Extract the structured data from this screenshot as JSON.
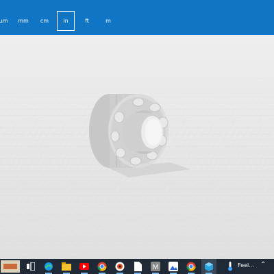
{
  "unit_toolbar": {
    "units": [
      {
        "label": "µm",
        "selected": false
      },
      {
        "label": "mm",
        "selected": false
      },
      {
        "label": "cm",
        "selected": false
      },
      {
        "label": "in",
        "selected": true
      },
      {
        "label": "ft",
        "selected": false
      },
      {
        "label": "m",
        "selected": false
      }
    ],
    "accent_color": "#0f75c4"
  },
  "viewport": {
    "model": "bearing-model"
  },
  "taskbar": {
    "items": [
      "task-view-icon",
      "edge-icon",
      "file-explorer-icon",
      "youtube-icon",
      "chrome-icon",
      "app-icon",
      "document-icon",
      "m-app-icon",
      "photos-icon",
      "chrome-icon",
      "3d-viewer-icon"
    ],
    "weather_text": "Feel...",
    "overflow_icon": "chevron-up-icon"
  }
}
